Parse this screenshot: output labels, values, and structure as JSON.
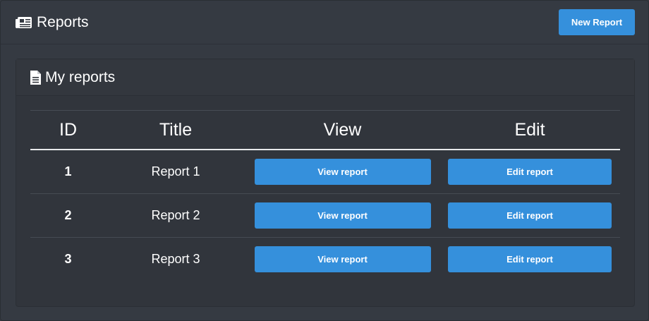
{
  "header": {
    "title": "Reports",
    "title_icon": "newspaper-icon",
    "new_report_label": "New Report"
  },
  "card": {
    "title": "My reports",
    "title_icon": "file-icon"
  },
  "table": {
    "headers": [
      "ID",
      "Title",
      "View",
      "Edit"
    ],
    "rows": [
      {
        "id": "1",
        "title": "Report 1",
        "view_label": "View report",
        "edit_label": "Edit report"
      },
      {
        "id": "2",
        "title": "Report 2",
        "view_label": "View report",
        "edit_label": "Edit report"
      },
      {
        "id": "3",
        "title": "Report 3",
        "view_label": "View report",
        "edit_label": "Edit report"
      }
    ]
  },
  "colors": {
    "background": "#353a42",
    "card": "#31353c",
    "accent": "#3590dc",
    "text": "#ffffff"
  }
}
